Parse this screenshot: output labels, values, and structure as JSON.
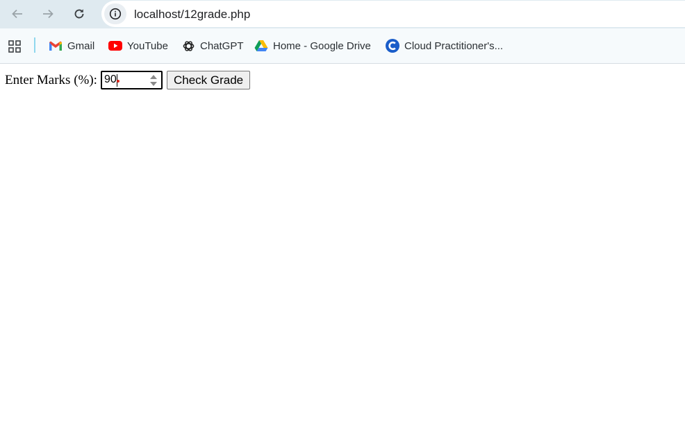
{
  "browser": {
    "url": "localhost/12grade.php",
    "bookmarks": [
      {
        "label": "Gmail",
        "icon": "gmail-icon"
      },
      {
        "label": "YouTube",
        "icon": "youtube-icon"
      },
      {
        "label": "ChatGPT",
        "icon": "chatgpt-icon"
      },
      {
        "label": "Home - Google Drive",
        "icon": "google-drive-icon"
      },
      {
        "label": "Cloud Practitioner's...",
        "icon": "cloud-practitioner-icon"
      }
    ]
  },
  "form": {
    "label": "Enter Marks (%):",
    "marks_value": "90",
    "submit_label": "Check Grade"
  },
  "colors": {
    "toolbar_bg": "#dfeaf0",
    "bookmarks_bg": "#f6fafc",
    "youtube_red": "#ff0000",
    "cloud_blue": "#1a5dc9"
  }
}
